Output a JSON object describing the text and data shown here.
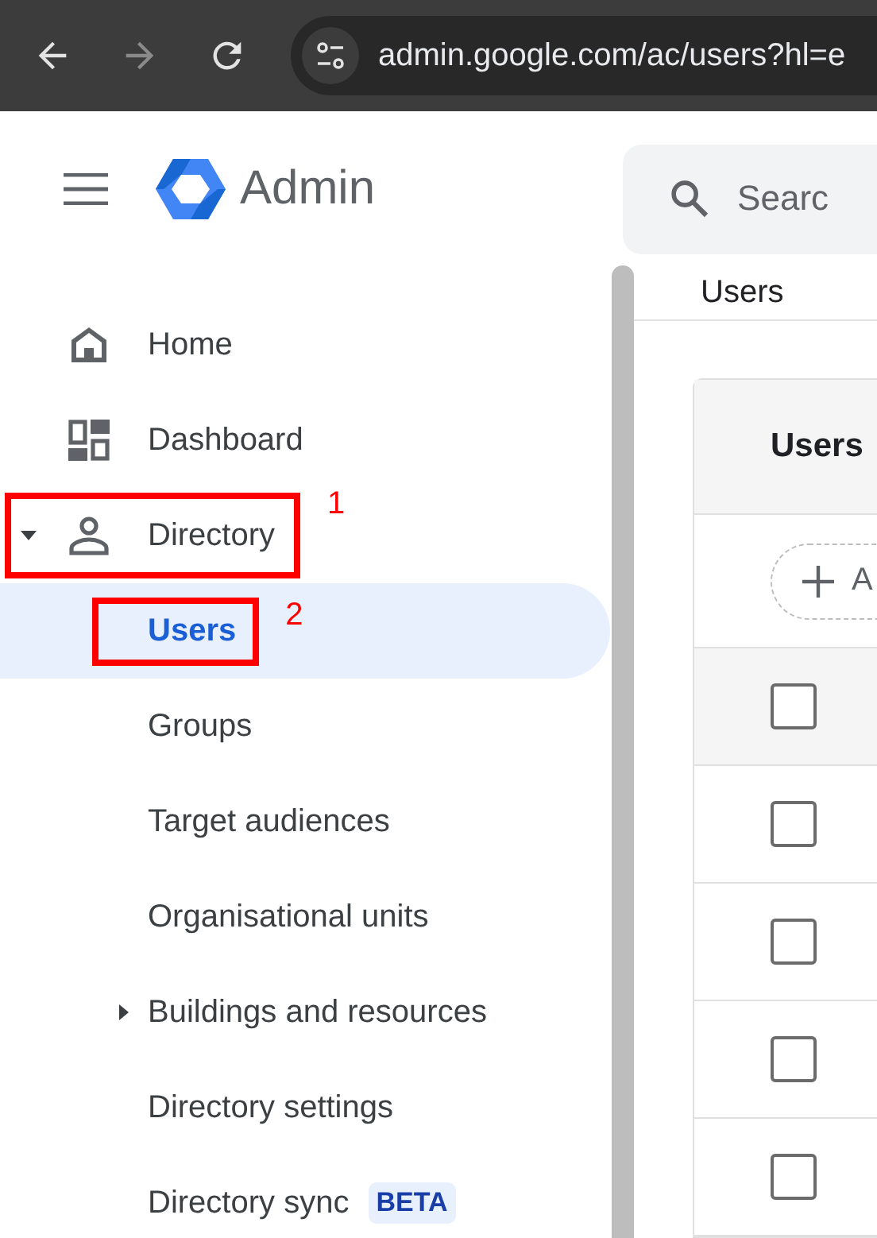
{
  "browser": {
    "url": "admin.google.com/ac/users?hl=e"
  },
  "header": {
    "app_name": "Admin",
    "search": {
      "placeholder": "Searc"
    }
  },
  "sidebar": {
    "items": [
      {
        "label": "Home",
        "selected": false
      },
      {
        "label": "Dashboard",
        "selected": false
      },
      {
        "label": "Directory",
        "selected": false,
        "expanded": true,
        "annotation": "1",
        "children": [
          {
            "label": "Users",
            "selected": true,
            "annotation": "2"
          },
          {
            "label": "Groups",
            "selected": false
          },
          {
            "label": "Target audiences",
            "selected": false
          },
          {
            "label": "Organisational units",
            "selected": false
          },
          {
            "label": "Buildings and resources",
            "selected": false,
            "expanded": false
          },
          {
            "label": "Directory settings",
            "selected": false
          },
          {
            "label": "Directory sync",
            "selected": false,
            "badge": "BETA"
          }
        ]
      }
    ]
  },
  "main": {
    "breadcrumb": "Users",
    "card": {
      "title": "Users",
      "filter_button": "A",
      "header_row": {
        "checked": false
      },
      "rows": [
        {
          "checked": false
        },
        {
          "checked": false
        },
        {
          "checked": false
        },
        {
          "checked": false
        }
      ]
    }
  }
}
